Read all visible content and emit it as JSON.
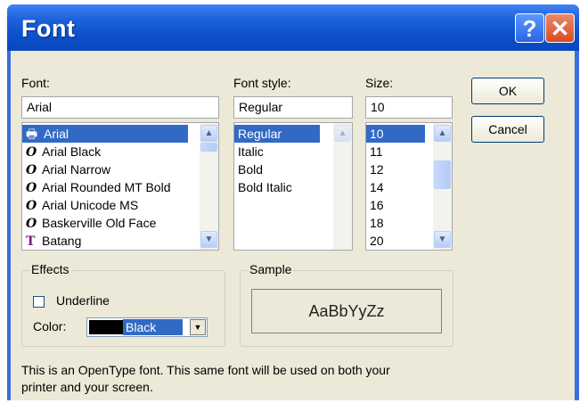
{
  "window": {
    "title": "Font",
    "help_glyph": "?",
    "close_glyph": "✕"
  },
  "font": {
    "label": "Font:",
    "value": "Arial",
    "items": [
      {
        "name": "Arial",
        "icon": "printer-font-icon",
        "glyph": "🖶",
        "selected": true
      },
      {
        "name": "Arial Black",
        "icon": "opentype-icon",
        "glyph": "O"
      },
      {
        "name": "Arial Narrow",
        "icon": "opentype-icon",
        "glyph": "O"
      },
      {
        "name": "Arial Rounded MT Bold",
        "icon": "opentype-icon",
        "glyph": "O"
      },
      {
        "name": "Arial Unicode MS",
        "icon": "opentype-icon",
        "glyph": "O"
      },
      {
        "name": "Baskerville Old Face",
        "icon": "opentype-icon",
        "glyph": "O"
      },
      {
        "name": "Batang",
        "icon": "truetype-icon",
        "glyph": "T"
      }
    ]
  },
  "style": {
    "label": "Font style:",
    "value": "Regular",
    "items": [
      "Regular",
      "Italic",
      "Bold",
      "Bold Italic"
    ]
  },
  "size": {
    "label": "Size:",
    "value": "10",
    "items": [
      "10",
      "11",
      "12",
      "14",
      "16",
      "18",
      "20"
    ]
  },
  "buttons": {
    "ok": "OK",
    "cancel": "Cancel"
  },
  "effects": {
    "title": "Effects",
    "underline_label": "Underline",
    "underline_checked": false,
    "color_label": "Color:",
    "color_value": "Black",
    "color_hex": "#000000"
  },
  "sample": {
    "title": "Sample",
    "text": "AaBbYyZz"
  },
  "description": {
    "line1": "This is an OpenType font. This same font will be used on both your",
    "line2": "printer and your screen."
  },
  "colors": {
    "selection": "#316ac5",
    "dialog_bg": "#ece9d8",
    "titlebar": "#0b4ec9",
    "close": "#d84a22"
  }
}
